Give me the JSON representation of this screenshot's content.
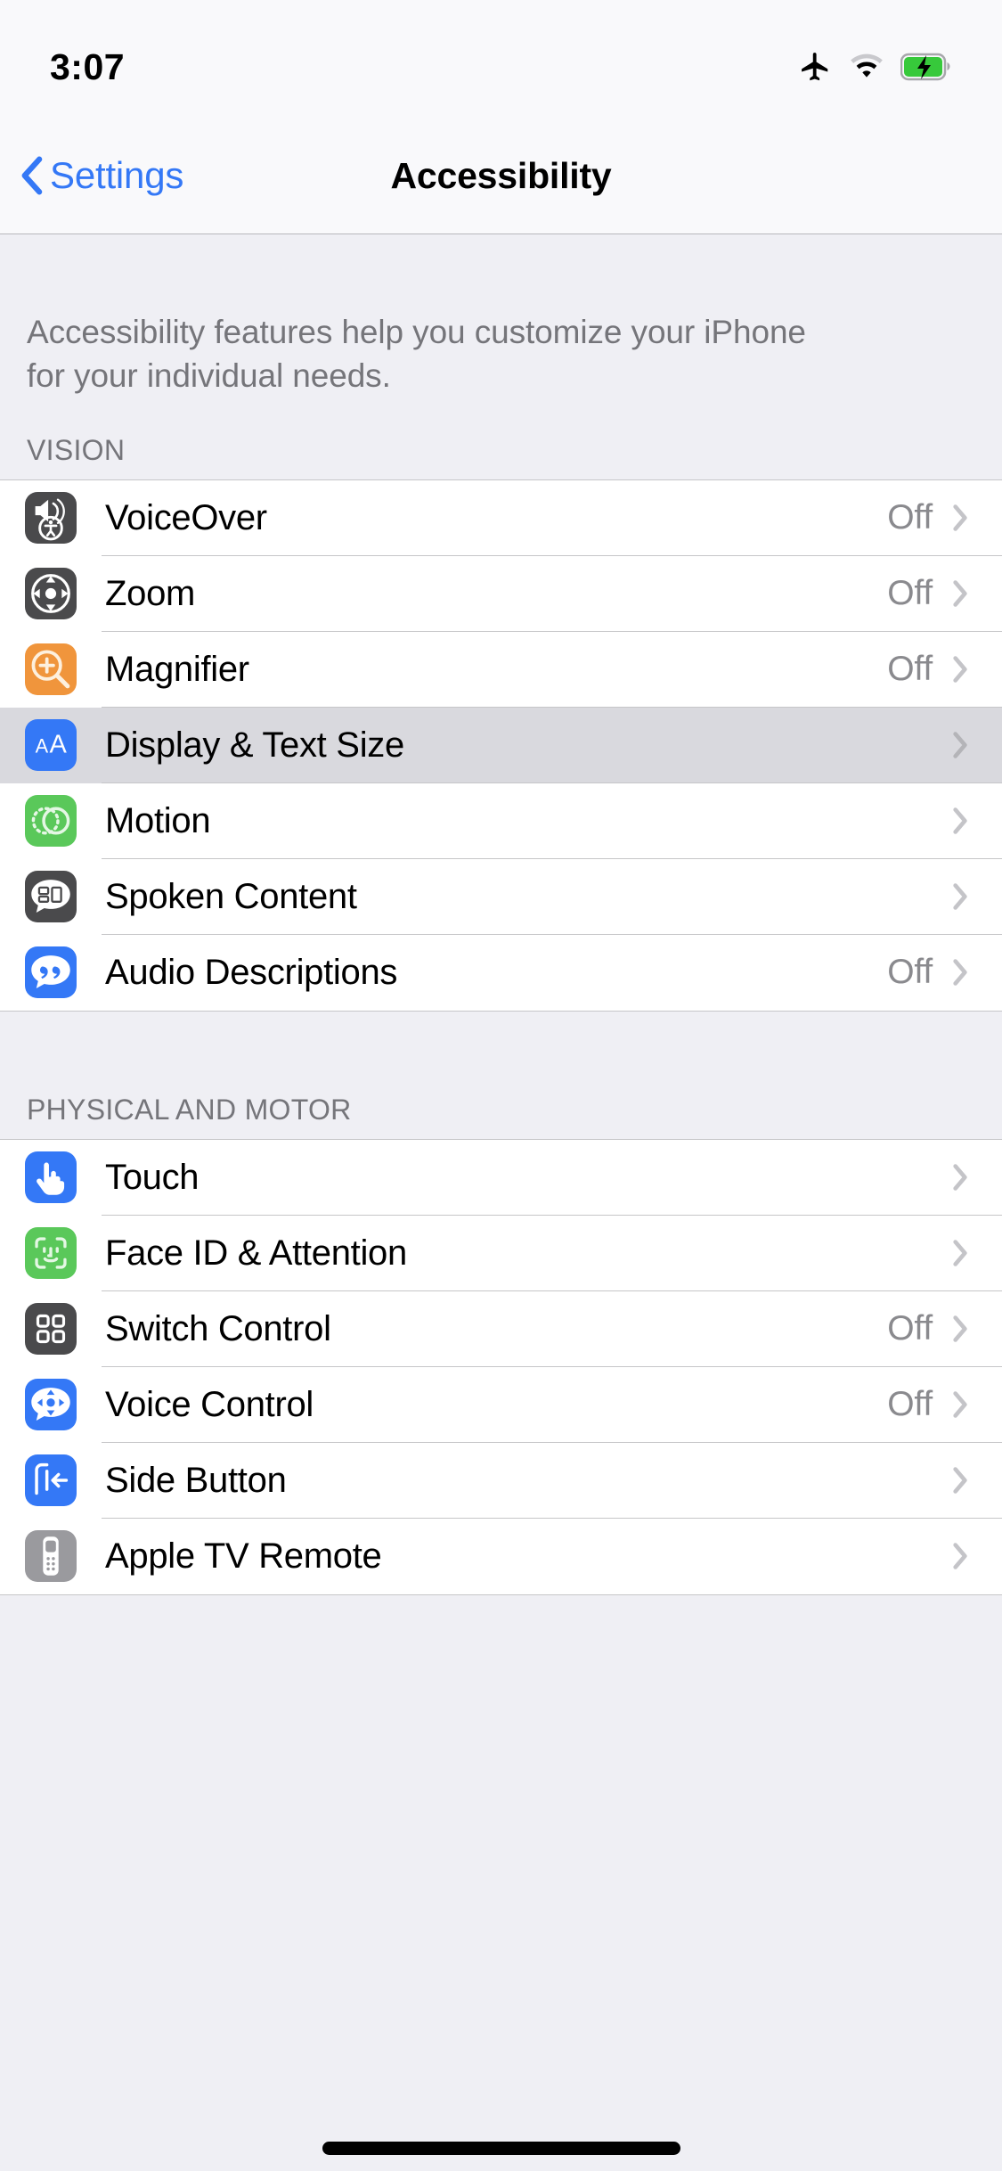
{
  "status_bar": {
    "time": "3:07",
    "icons": [
      "airplane-mode-icon",
      "wifi-icon",
      "battery-charging-icon"
    ],
    "battery_charging": true
  },
  "nav_bar": {
    "back_label": "Settings",
    "back_icon": "chevron-left-icon",
    "title": "Accessibility"
  },
  "intro": {
    "line1": "Accessibility features help you customize your iPhone",
    "line2": "for your individual needs."
  },
  "sections": [
    {
      "header": "VISION",
      "rows": [
        {
          "label": "VoiceOver",
          "value": "Off",
          "icon": "voiceover-icon",
          "icon_color": "#4a4a4c",
          "chevron": true,
          "highlight": false
        },
        {
          "label": "Zoom",
          "value": "Off",
          "icon": "zoom-icon",
          "icon_color": "#4a4a4c",
          "chevron": true,
          "highlight": false
        },
        {
          "label": "Magnifier",
          "value": "Off",
          "icon": "magnifier-icon",
          "icon_color": "#f0953c",
          "chevron": true,
          "highlight": false
        },
        {
          "label": "Display & Text Size",
          "value": "",
          "icon": "display-text-size-icon",
          "icon_color": "#3478f6",
          "chevron": true,
          "highlight": true
        },
        {
          "label": "Motion",
          "value": "",
          "icon": "motion-icon",
          "icon_color": "#5ac85a",
          "chevron": true,
          "highlight": false
        },
        {
          "label": "Spoken Content",
          "value": "",
          "icon": "spoken-content-icon",
          "icon_color": "#4a4a4c",
          "chevron": true,
          "highlight": false
        },
        {
          "label": "Audio Descriptions",
          "value": "Off",
          "icon": "audio-descriptions-icon",
          "icon_color": "#3478f6",
          "chevron": true,
          "highlight": false
        }
      ]
    },
    {
      "header": "PHYSICAL AND MOTOR",
      "rows": [
        {
          "label": "Touch",
          "value": "",
          "icon": "touch-icon",
          "icon_color": "#3478f6",
          "chevron": true,
          "highlight": false
        },
        {
          "label": "Face ID & Attention",
          "value": "",
          "icon": "face-id-icon",
          "icon_color": "#5ac85a",
          "chevron": true,
          "highlight": false
        },
        {
          "label": "Switch Control",
          "value": "Off",
          "icon": "switch-control-icon",
          "icon_color": "#4a4a4c",
          "chevron": true,
          "highlight": false
        },
        {
          "label": "Voice Control",
          "value": "Off",
          "icon": "voice-control-icon",
          "icon_color": "#3478f6",
          "chevron": true,
          "highlight": false
        },
        {
          "label": "Side Button",
          "value": "",
          "icon": "side-button-icon",
          "icon_color": "#3478f6",
          "chevron": true,
          "highlight": false
        },
        {
          "label": "Apple TV Remote",
          "value": "",
          "icon": "apple-tv-remote-icon",
          "icon_color": "#9a9a9e",
          "chevron": true,
          "highlight": false
        }
      ]
    }
  ],
  "colors": {
    "accent_blue": "#3478f6",
    "group_bg": "#efeff4",
    "row_bg": "#ffffff",
    "highlight_bg": "#d9d9de",
    "separator": "#c6c6c8",
    "secondary_text": "#8a8a8e",
    "header_text": "#75757a"
  }
}
